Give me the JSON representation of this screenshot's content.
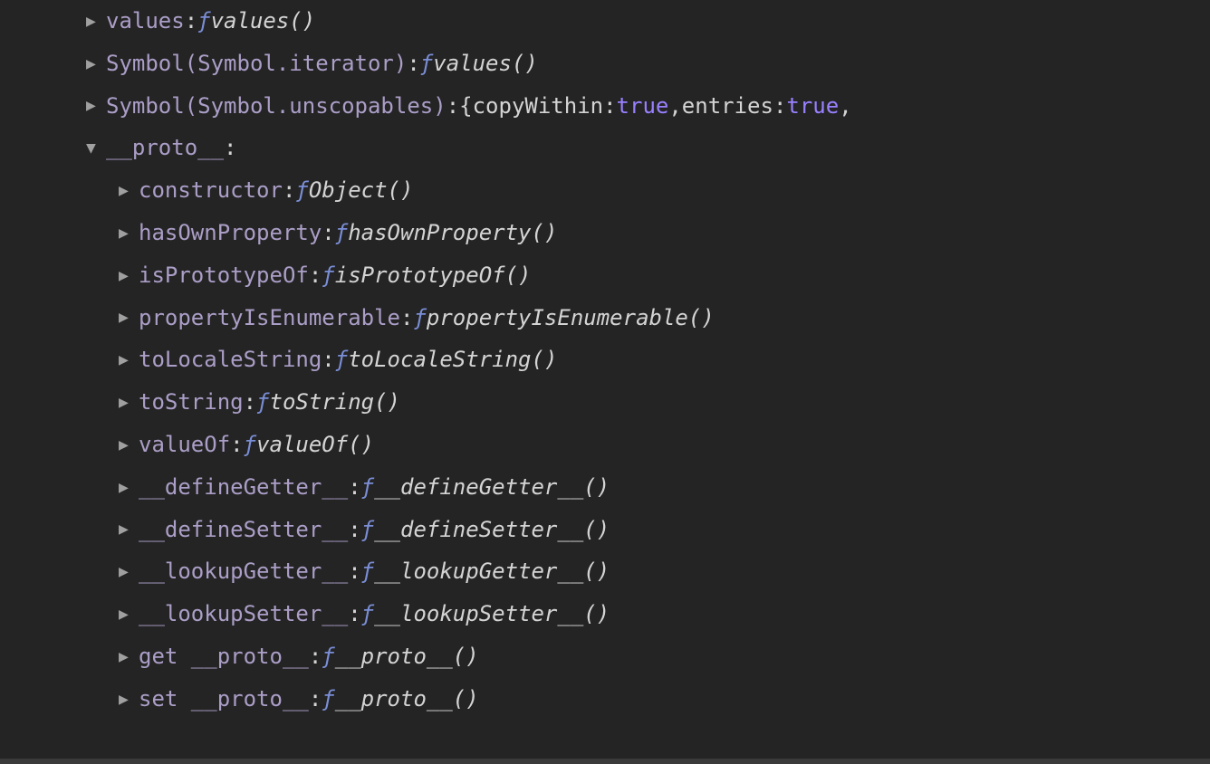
{
  "rows": [
    {
      "indent": 1,
      "expanded": false,
      "key": "values",
      "type": "function",
      "fname": "values()"
    },
    {
      "indent": 1,
      "expanded": false,
      "key": "Symbol(Symbol.iterator)",
      "type": "function",
      "fname": "values()"
    },
    {
      "indent": 1,
      "expanded": false,
      "key": "Symbol(Symbol.unscopables)",
      "type": "object",
      "objtext": {
        "prefix": "{",
        "k1": "copyWithin",
        "v1": "true",
        "sep1": ", ",
        "k2": "entries",
        "v2": "true",
        "trail": ","
      }
    },
    {
      "indent": 1,
      "expanded": true,
      "key": "__proto__",
      "type": "none"
    },
    {
      "indent": 2,
      "expanded": false,
      "key": "constructor",
      "type": "function",
      "fname": "Object()"
    },
    {
      "indent": 2,
      "expanded": false,
      "key": "hasOwnProperty",
      "type": "function",
      "fname": "hasOwnProperty()"
    },
    {
      "indent": 2,
      "expanded": false,
      "key": "isPrototypeOf",
      "type": "function",
      "fname": "isPrototypeOf()"
    },
    {
      "indent": 2,
      "expanded": false,
      "key": "propertyIsEnumerable",
      "type": "function",
      "fname": "propertyIsEnumerable()"
    },
    {
      "indent": 2,
      "expanded": false,
      "key": "toLocaleString",
      "type": "function",
      "fname": "toLocaleString()"
    },
    {
      "indent": 2,
      "expanded": false,
      "key": "toString",
      "type": "function",
      "fname": "toString()"
    },
    {
      "indent": 2,
      "expanded": false,
      "key": "valueOf",
      "type": "function",
      "fname": "valueOf()"
    },
    {
      "indent": 2,
      "expanded": false,
      "key": "__defineGetter__",
      "type": "function",
      "fname": "__defineGetter__()"
    },
    {
      "indent": 2,
      "expanded": false,
      "key": "__defineSetter__",
      "type": "function",
      "fname": "__defineSetter__()"
    },
    {
      "indent": 2,
      "expanded": false,
      "key": "__lookupGetter__",
      "type": "function",
      "fname": "__lookupGetter__()"
    },
    {
      "indent": 2,
      "expanded": false,
      "key": "__lookupSetter__",
      "type": "function",
      "fname": "__lookupSetter__()"
    },
    {
      "indent": 2,
      "expanded": false,
      "key": "get __proto__",
      "type": "function",
      "fname": "__proto__()"
    },
    {
      "indent": 2,
      "expanded": false,
      "key": "set __proto__",
      "type": "function",
      "fname": "__proto__()"
    }
  ],
  "glyphs": {
    "f": "ƒ",
    "tri_right": "▶",
    "tri_down": "▼"
  }
}
